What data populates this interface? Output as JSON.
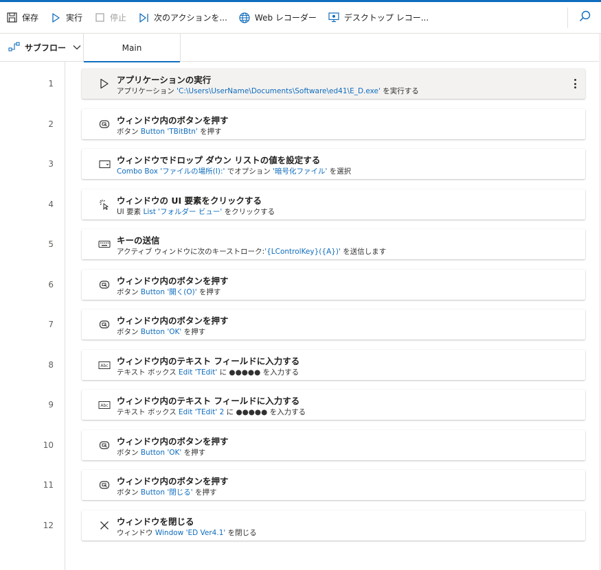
{
  "toolbar": {
    "save": "保存",
    "run": "実行",
    "stop": "停止",
    "next_action": "次のアクションを...",
    "web_recorder": "Web レコーダー",
    "desktop_recorder": "デスクトップ レコー..."
  },
  "tabs": {
    "subflow": "サブフロー",
    "main": "Main"
  },
  "colors": {
    "accent": "#0f6cbd",
    "text": "#201f1e",
    "link": "#0f6cbd"
  },
  "actions": [
    {
      "num": "1",
      "icon": "play-icon",
      "title": "アプリケーションの実行",
      "desc": [
        {
          "t": "アプリケーション "
        },
        {
          "t": "'C:\\Users\\UserName\\Documents\\Software\\ed41\\E_D.exe'",
          "link": true
        },
        {
          "t": " を実行する"
        }
      ]
    },
    {
      "num": "2",
      "icon": "window-button-icon",
      "title": "ウィンドウ内のボタンを押す",
      "desc": [
        {
          "t": "ボタン "
        },
        {
          "t": "Button 'TBitBtn'",
          "link": true
        },
        {
          "t": " を押す"
        }
      ]
    },
    {
      "num": "3",
      "icon": "dropdown-icon",
      "title": "ウィンドウでドロップ ダウン リストの値を設定する",
      "desc": [
        {
          "t": "Combo Box 'ファイルの場所(I):'",
          "link": true
        },
        {
          "t": " でオプション "
        },
        {
          "t": "'暗号化ファイル'",
          "link": true
        },
        {
          "t": " を選択"
        }
      ]
    },
    {
      "num": "4",
      "icon": "click-icon",
      "title": "ウィンドウの UI 要素をクリックする",
      "desc": [
        {
          "t": "UI 要素 "
        },
        {
          "t": "List 'フォルダー ビュー'",
          "link": true
        },
        {
          "t": " をクリックする"
        }
      ]
    },
    {
      "num": "5",
      "icon": "keyboard-icon",
      "title": "キーの送信",
      "desc": [
        {
          "t": "アクティブ ウィンドウに次のキーストローク:"
        },
        {
          "t": "'{LControlKey}({A})'",
          "link": true
        },
        {
          "t": " を送信します"
        }
      ]
    },
    {
      "num": "6",
      "icon": "window-button-icon",
      "title": "ウィンドウ内のボタンを押す",
      "desc": [
        {
          "t": "ボタン "
        },
        {
          "t": "Button '開く(O)'",
          "link": true
        },
        {
          "t": " を押す"
        }
      ]
    },
    {
      "num": "7",
      "icon": "window-button-icon",
      "title": "ウィンドウ内のボタンを押す",
      "desc": [
        {
          "t": "ボタン "
        },
        {
          "t": "Button 'OK'",
          "link": true
        },
        {
          "t": " を押す"
        }
      ]
    },
    {
      "num": "8",
      "icon": "text-field-icon",
      "title": "ウィンドウ内のテキスト フィールドに入力する",
      "desc": [
        {
          "t": "テキスト ボックス "
        },
        {
          "t": "Edit 'TEdit'",
          "link": true
        },
        {
          "t": " に ●●●●● を入力する"
        }
      ]
    },
    {
      "num": "9",
      "icon": "text-field-icon",
      "title": "ウィンドウ内のテキスト フィールドに入力する",
      "desc": [
        {
          "t": "テキスト ボックス "
        },
        {
          "t": "Edit 'TEdit' 2",
          "link": true
        },
        {
          "t": " に ●●●●● を入力する"
        }
      ]
    },
    {
      "num": "10",
      "icon": "window-button-icon",
      "title": "ウィンドウ内のボタンを押す",
      "desc": [
        {
          "t": "ボタン "
        },
        {
          "t": "Button 'OK'",
          "link": true
        },
        {
          "t": " を押す"
        }
      ]
    },
    {
      "num": "11",
      "icon": "window-button-icon",
      "title": "ウィンドウ内のボタンを押す",
      "desc": [
        {
          "t": "ボタン "
        },
        {
          "t": "Button '閉じる'",
          "link": true
        },
        {
          "t": " を押す"
        }
      ]
    },
    {
      "num": "12",
      "icon": "close-window-icon",
      "title": "ウィンドウを閉じる",
      "desc": [
        {
          "t": "ウィンドウ "
        },
        {
          "t": "Window 'ED Ver4.1'",
          "link": true
        },
        {
          "t": " を閉じる"
        }
      ]
    }
  ]
}
